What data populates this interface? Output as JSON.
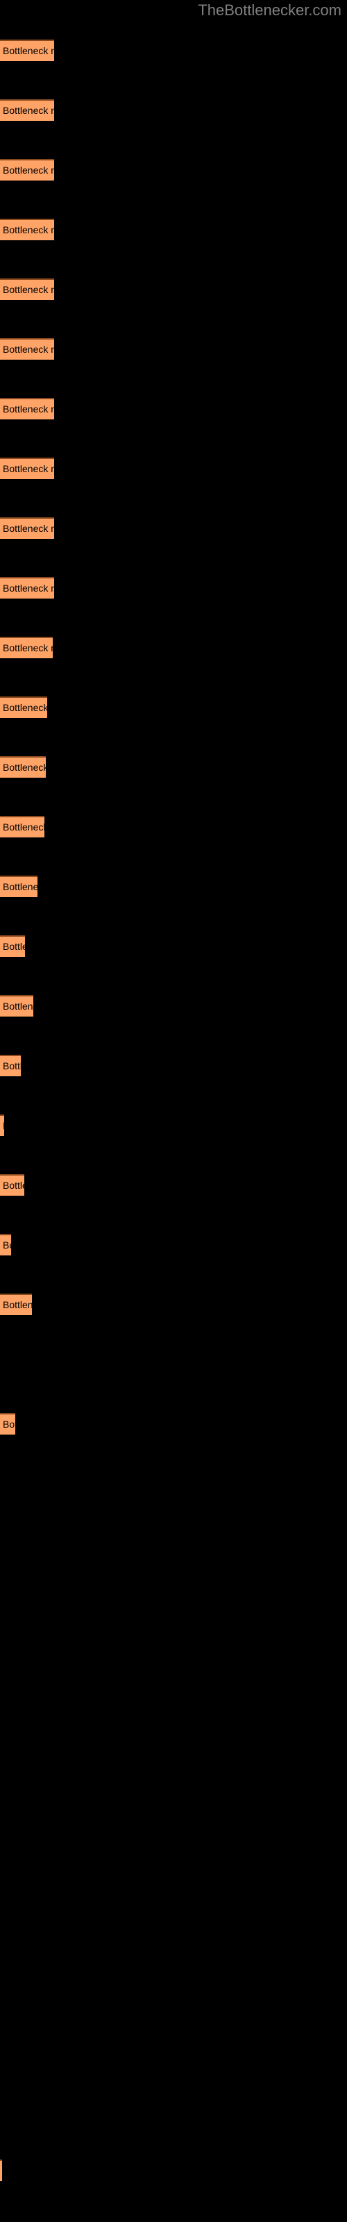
{
  "header": {
    "title": "TheBottlenecker.com",
    "title_color": "#808080"
  },
  "colors": {
    "background": "#000000",
    "bar_fill": "#ffa366",
    "bar_top_border": "#8c4a1e",
    "bar_label": "#000000",
    "title": "#808080"
  },
  "chart_data": {
    "type": "bar",
    "orientation": "horizontal",
    "title": "TheBottlenecker.com",
    "xlabel": "",
    "ylabel": "",
    "grid": false,
    "legend": false,
    "bar_label_text": "Bottleneck result",
    "categories": [
      "Bottleneck result",
      "Bottleneck result",
      "Bottleneck result",
      "Bottleneck result",
      "Bottleneck result",
      "Bottleneck result",
      "Bottleneck result",
      "Bottleneck result",
      "Bottleneck result",
      "Bottleneck result",
      "Bottleneck result",
      "Bottleneck result",
      "Bottleneck result",
      "Bottleneck result",
      "Bottleneck result",
      "Bottleneck result",
      "Bottleneck result",
      "Bottleneck result",
      "Bottleneck result",
      "Bottleneck result",
      "Bottleneck result",
      "Bottleneck result",
      "Bottleneck result",
      "Bottleneck result"
    ],
    "values": [
      78,
      78,
      78,
      78,
      78,
      78,
      78,
      78,
      78,
      78,
      76,
      68,
      66,
      64,
      54,
      36,
      48,
      30,
      6,
      35,
      16,
      0,
      46,
      3
    ],
    "xlim": [
      0,
      500
    ],
    "bars": [
      {
        "index": 1,
        "label": "Bottleneck result",
        "width": 78,
        "top": 57,
        "visible_text": "Bottleneck result"
      },
      {
        "index": 2,
        "label": "Bottleneck result",
        "width": 78,
        "top": 143,
        "visible_text": "Bottleneck result"
      },
      {
        "index": 3,
        "label": "Bottleneck result",
        "width": 78,
        "top": 229,
        "visible_text": "Bottleneck result"
      },
      {
        "index": 4,
        "label": "Bottleneck result",
        "width": 78,
        "top": 315,
        "visible_text": "Bottleneck result"
      },
      {
        "index": 5,
        "label": "Bottleneck result",
        "width": 78,
        "top": 401,
        "visible_text": "Bottleneck result"
      },
      {
        "index": 6,
        "label": "Bottleneck result",
        "width": 78,
        "top": 487,
        "visible_text": "Bottleneck result"
      },
      {
        "index": 7,
        "label": "Bottleneck result",
        "width": 78,
        "top": 573,
        "visible_text": "Bottleneck result"
      },
      {
        "index": 8,
        "label": "Bottleneck result",
        "width": 78,
        "top": 659,
        "visible_text": "Bottleneck result"
      },
      {
        "index": 9,
        "label": "Bottleneck result",
        "width": 78,
        "top": 745,
        "visible_text": "Bottleneck result"
      },
      {
        "index": 10,
        "label": "Bottleneck result",
        "width": 78,
        "top": 831,
        "visible_text": "Bottleneck result"
      },
      {
        "index": 11,
        "label": "Bottleneck result",
        "width": 76,
        "top": 917,
        "visible_text": "Bottleneck resul"
      },
      {
        "index": 12,
        "label": "Bottleneck result",
        "width": 68,
        "top": 1003,
        "visible_text": "Bottleneck resu"
      },
      {
        "index": 13,
        "label": "Bottleneck result",
        "width": 66,
        "top": 1089,
        "visible_text": "Bottleneck resu"
      },
      {
        "index": 14,
        "label": "Bottleneck result",
        "width": 64,
        "top": 1175,
        "visible_text": "Bottleneck res"
      },
      {
        "index": 15,
        "label": "Bottleneck result",
        "width": 54,
        "top": 1261,
        "visible_text": "Bottleneck"
      },
      {
        "index": 16,
        "label": "Bottleneck result",
        "width": 36,
        "top": 1347,
        "visible_text": "Bottle"
      },
      {
        "index": 17,
        "label": "Bottleneck result",
        "width": 48,
        "top": 1433,
        "visible_text": "Bottlenec"
      },
      {
        "index": 18,
        "label": "Bottleneck result",
        "width": 30,
        "top": 1519,
        "visible_text": "Bott"
      },
      {
        "index": 19,
        "label": "Bottleneck result",
        "width": 6,
        "top": 1605,
        "visible_text": ""
      },
      {
        "index": 20,
        "label": "Bottleneck result",
        "width": 35,
        "top": 1691,
        "visible_text": "Bottl"
      },
      {
        "index": 21,
        "label": "Bottleneck result",
        "width": 16,
        "top": 1777,
        "visible_text": "Bo"
      },
      {
        "index": 22,
        "label": "Bottleneck result",
        "width": 46,
        "top": 1863,
        "visible_text": "Bottler"
      },
      {
        "index": 23,
        "label": "Bottleneck result",
        "width": 0,
        "top": 1949,
        "visible_text": ""
      },
      {
        "index": 24,
        "label": "Bottleneck result",
        "width": 22,
        "top": 2035,
        "visible_text": "Bot"
      },
      {
        "index": 25,
        "label": "Bottleneck result",
        "width": 3,
        "top": 3110,
        "visible_text": ""
      }
    ]
  }
}
